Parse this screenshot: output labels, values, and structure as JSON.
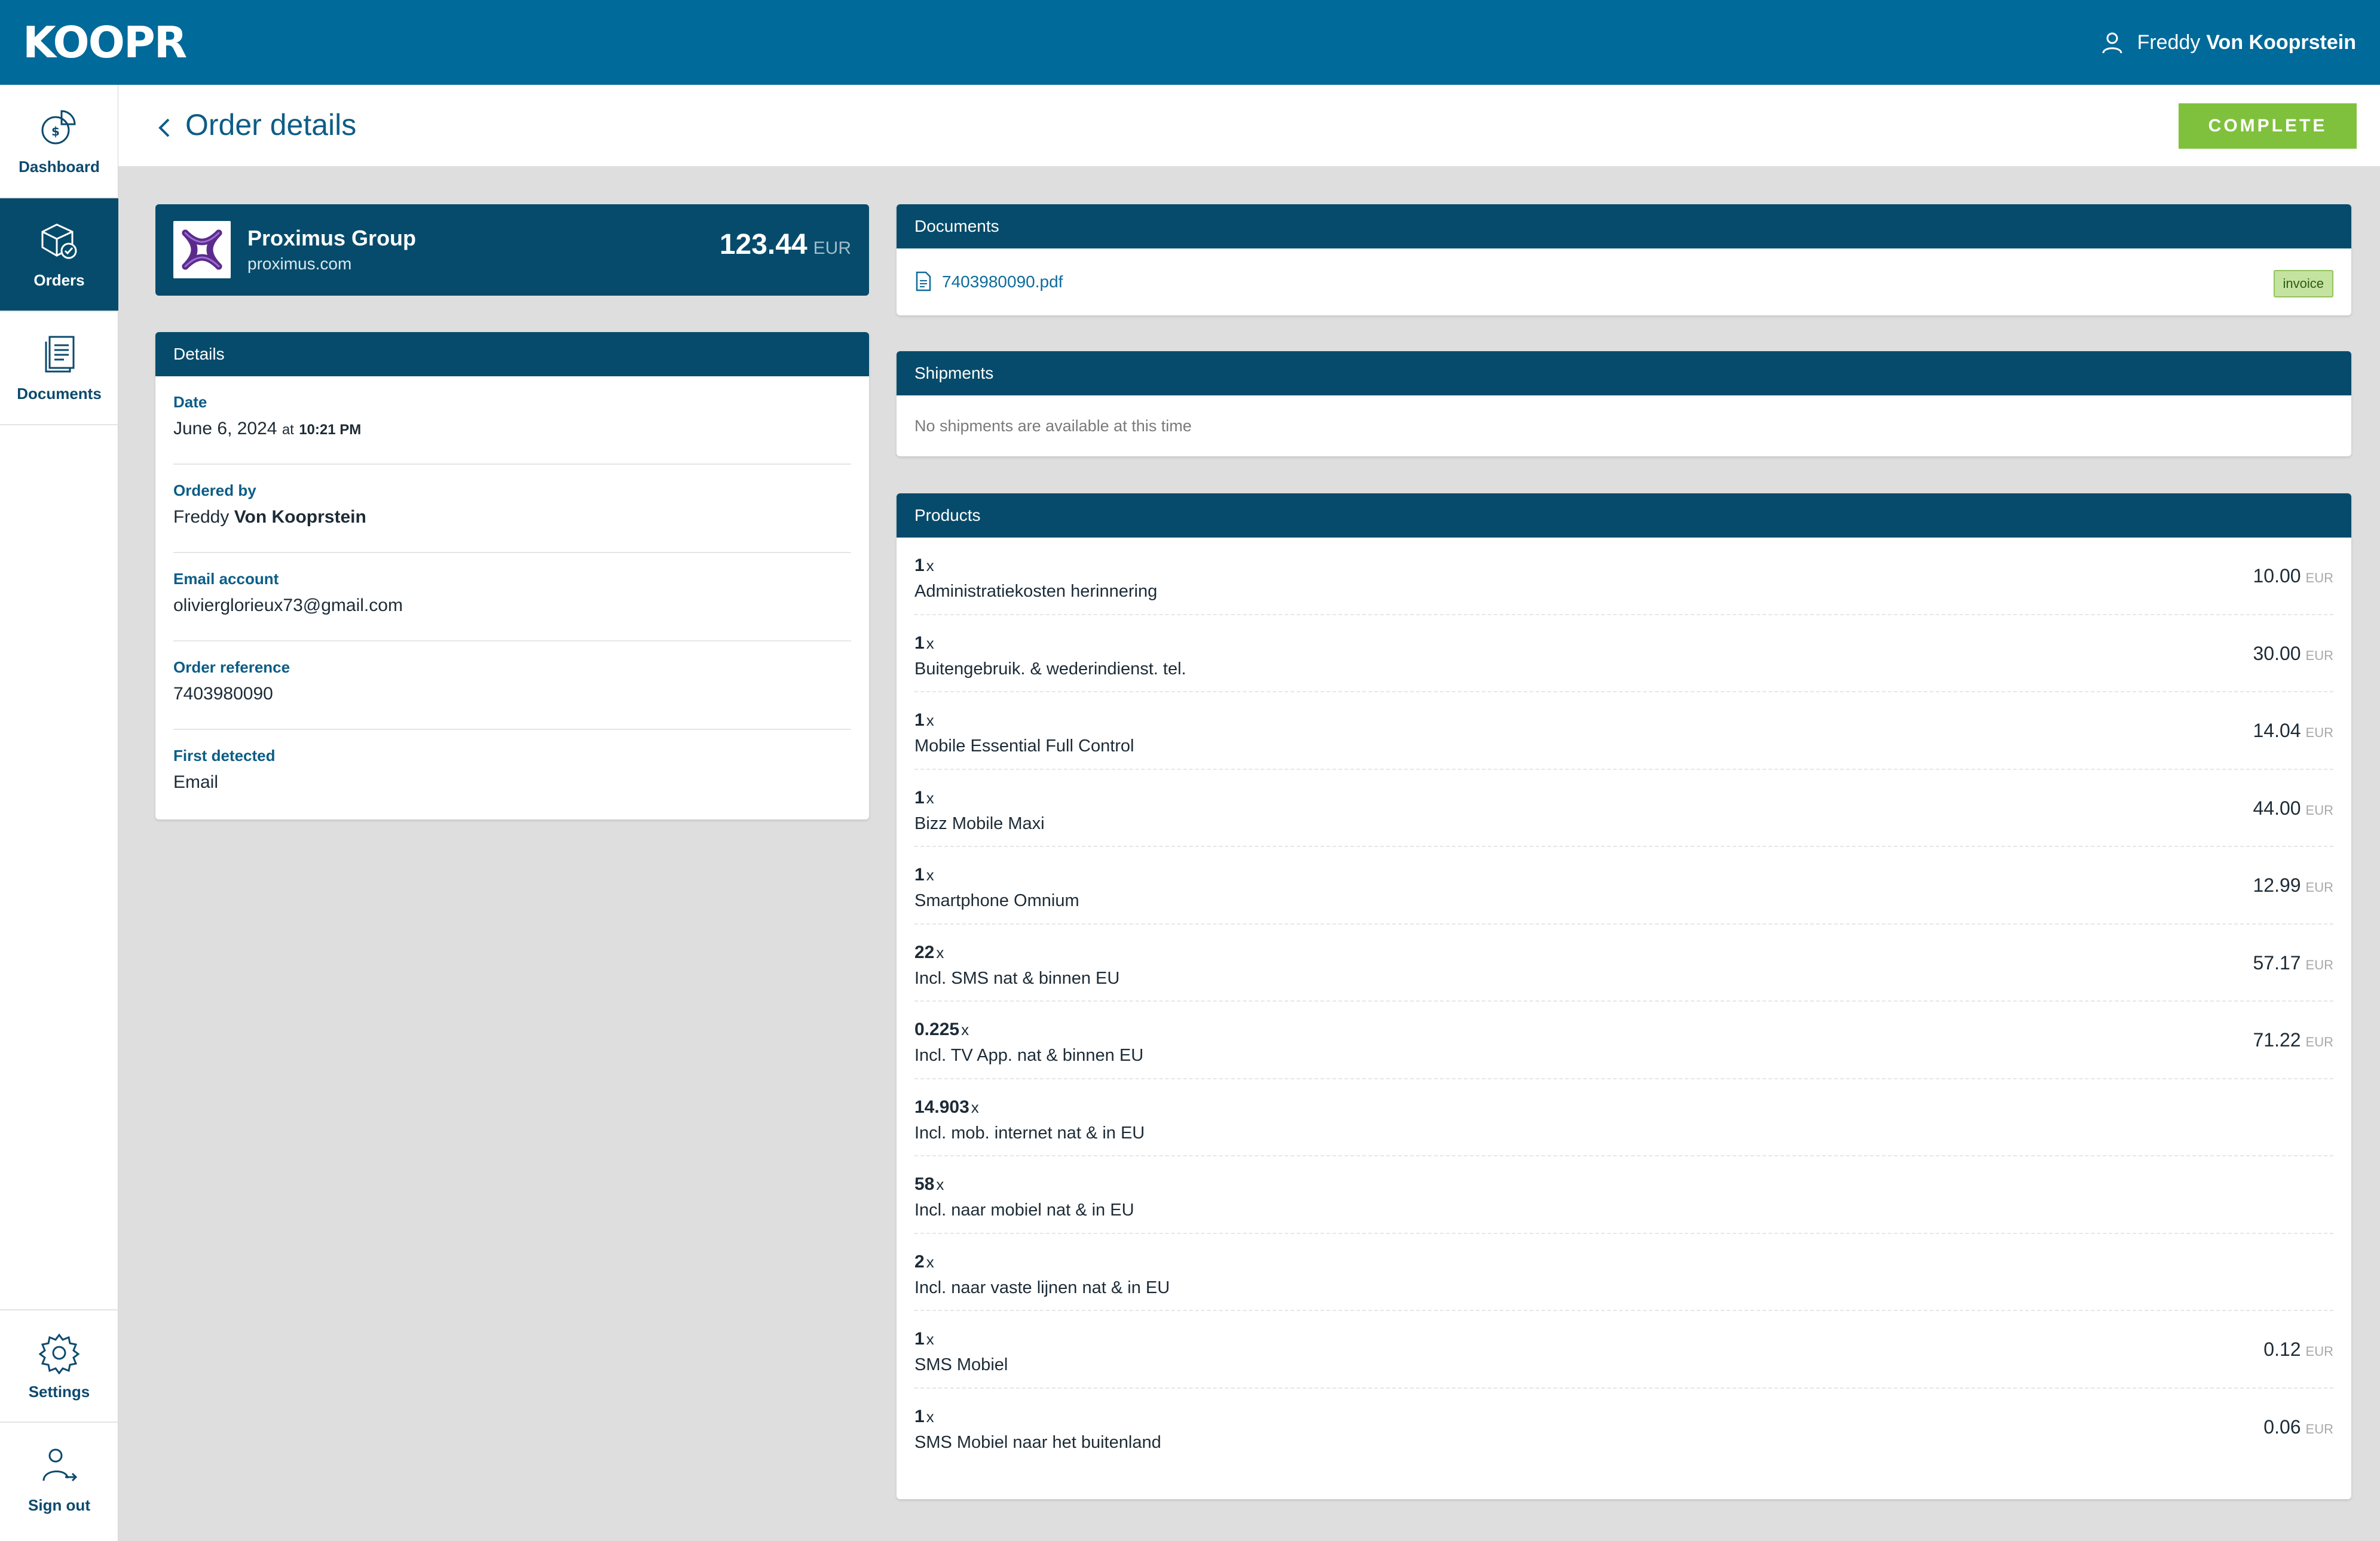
{
  "app": {
    "logo": "KOOPR"
  },
  "user": {
    "first": "Freddy",
    "last": "Von Kooprstein"
  },
  "sidebar": {
    "items": [
      {
        "label": "Dashboard",
        "icon": "dashboard-icon"
      },
      {
        "label": "Orders",
        "icon": "orders-box-icon",
        "active": true
      },
      {
        "label": "Documents",
        "icon": "documents-icon"
      },
      {
        "label": "Settings",
        "icon": "gear-icon"
      },
      {
        "label": "Sign out",
        "icon": "sign-out-icon"
      }
    ]
  },
  "header": {
    "title": "Order details",
    "complete_label": "COMPLETE"
  },
  "merchant": {
    "name": "Proximus Group",
    "domain": "proximus.com",
    "total": "123.44",
    "currency": "EUR"
  },
  "details": {
    "title": "Details",
    "date_label": "Date",
    "date": "June 6, 2024",
    "at": "at",
    "time": "10:21 PM",
    "ordered_by_label": "Ordered by",
    "ordered_by_first": "Freddy",
    "ordered_by_last": "Von Kooprstein",
    "email_label": "Email account",
    "email": "olivierglorieux73@gmail.com",
    "reference_label": "Order reference",
    "reference": "7403980090",
    "detected_label": "First detected",
    "detected": "Email"
  },
  "documents": {
    "title": "Documents",
    "file": "7403980090.pdf",
    "badge": "invoice"
  },
  "shipments": {
    "title": "Shipments",
    "empty": "No shipments are available at this time"
  },
  "products": {
    "title": "Products",
    "qty_suffix": "x",
    "currency": "EUR",
    "items": [
      {
        "qty": "1",
        "name": "Administratiekosten herinnering",
        "price": "10.00"
      },
      {
        "qty": "1",
        "name": "Buitengebruik. & wederindienst. tel.",
        "price": "30.00"
      },
      {
        "qty": "1",
        "name": "Mobile Essential Full Control",
        "price": "14.04"
      },
      {
        "qty": "1",
        "name": "Bizz Mobile Maxi",
        "price": "44.00"
      },
      {
        "qty": "1",
        "name": "Smartphone Omnium",
        "price": "12.99"
      },
      {
        "qty": "22",
        "name": "Incl. SMS nat & binnen EU",
        "price": "57.17"
      },
      {
        "qty": "0.225",
        "name": "Incl. TV App. nat & binnen EU",
        "price": "71.22"
      },
      {
        "qty": "14.903",
        "name": "Incl. mob. internet nat & in EU",
        "price": ""
      },
      {
        "qty": "58",
        "name": "Incl. naar mobiel nat & in EU",
        "price": ""
      },
      {
        "qty": "2",
        "name": "Incl. naar vaste lijnen nat & in EU",
        "price": ""
      },
      {
        "qty": "1",
        "name": "SMS Mobiel",
        "price": "0.12"
      },
      {
        "qty": "1",
        "name": "SMS Mobiel naar het buitenland",
        "price": "0.06"
      }
    ]
  },
  "colors": {
    "topbar": "#006a9a",
    "navy": "#064b6b",
    "accent_green": "#7fc13c",
    "link": "#0d6c9b"
  }
}
